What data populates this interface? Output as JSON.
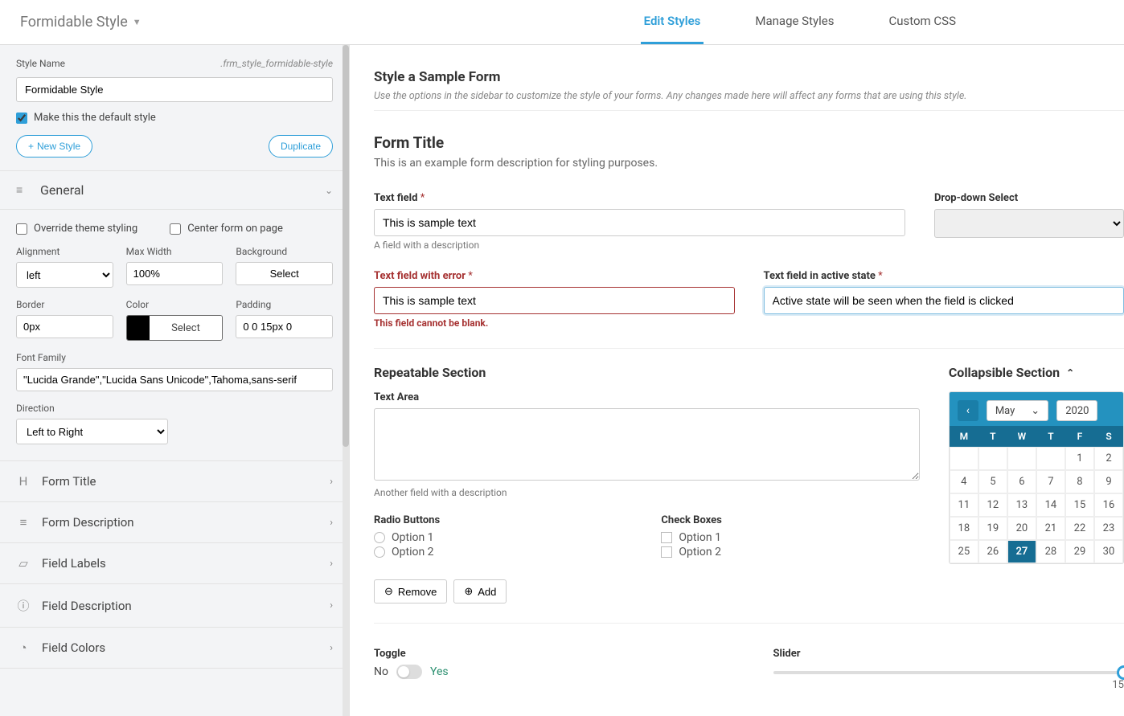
{
  "header": {
    "title": "Formidable Style",
    "tabs": [
      "Edit Styles",
      "Manage Styles",
      "Custom CSS"
    ],
    "active_tab": 0
  },
  "sidebar": {
    "style_name_label": "Style Name",
    "style_class": ".frm_style_formidable-style",
    "style_name_value": "Formidable Style",
    "default_check_label": "Make this the default style",
    "default_checked": true,
    "new_style_label": "New Style",
    "duplicate_label": "Duplicate",
    "general": {
      "title": "General",
      "override_label": "Override theme styling",
      "center_label": "Center form on page",
      "alignment_label": "Alignment",
      "alignment_value": "left",
      "max_width_label": "Max Width",
      "max_width_value": "100%",
      "background_label": "Background",
      "background_value": "Select",
      "border_label": "Border",
      "border_value": "0px",
      "color_label": "Color",
      "color_btn": "Select",
      "padding_label": "Padding",
      "padding_value": "0 0 15px 0",
      "font_label": "Font Family",
      "font_value": "\"Lucida Grande\",\"Lucida Sans Unicode\",Tahoma,sans-serif",
      "direction_label": "Direction",
      "direction_value": "Left to Right"
    },
    "panels": [
      {
        "icon": "H",
        "title": "Form Title"
      },
      {
        "icon": "≡",
        "title": "Form Description"
      },
      {
        "icon": "▱",
        "title": "Field Labels"
      },
      {
        "icon": "ⓘ",
        "title": "Field Description"
      },
      {
        "icon": "◔",
        "title": "Field Colors"
      }
    ]
  },
  "main": {
    "page_title": "Style a Sample Form",
    "page_subtitle": "Use the options in the sidebar to customize the style of your forms. Any changes made here will affect any forms that are using this style.",
    "form_title": "Form Title",
    "form_desc": "This is an example form description for styling purposes.",
    "text_field_label": "Text field",
    "text_field_value": "This is sample text",
    "text_field_desc": "A field with a description",
    "dropdown_label": "Drop-down Select",
    "error_field_label": "Text field with error",
    "error_field_value": "This is sample text",
    "error_msg": "This field cannot be blank.",
    "active_field_label": "Text field in active state",
    "active_field_value": "Active state will be seen when the field is clicked",
    "repeatable_title": "Repeatable Section",
    "collapsible_title": "Collapsible Section",
    "textarea_label": "Text Area",
    "textarea_desc": "Another field with a description",
    "radio_label": "Radio Buttons",
    "radio_options": [
      "Option 1",
      "Option 2"
    ],
    "check_label": "Check Boxes",
    "check_options": [
      "Option 1",
      "Option 2"
    ],
    "remove_label": "Remove",
    "add_label": "Add",
    "calendar": {
      "month": "May",
      "year": "2020",
      "days": [
        "M",
        "T",
        "W",
        "T",
        "F",
        "S"
      ],
      "weeks": [
        [
          "",
          "",
          "",
          "",
          "1",
          "2"
        ],
        [
          "4",
          "5",
          "6",
          "7",
          "8",
          "9"
        ],
        [
          "11",
          "12",
          "13",
          "14",
          "15",
          "16"
        ],
        [
          "18",
          "19",
          "20",
          "21",
          "22",
          "23"
        ],
        [
          "25",
          "26",
          "27",
          "28",
          "29",
          "30"
        ]
      ],
      "selected": "27"
    },
    "toggle_label": "Toggle",
    "toggle_no": "No",
    "toggle_yes": "Yes",
    "slider_label": "Slider",
    "slider_value": "15"
  }
}
